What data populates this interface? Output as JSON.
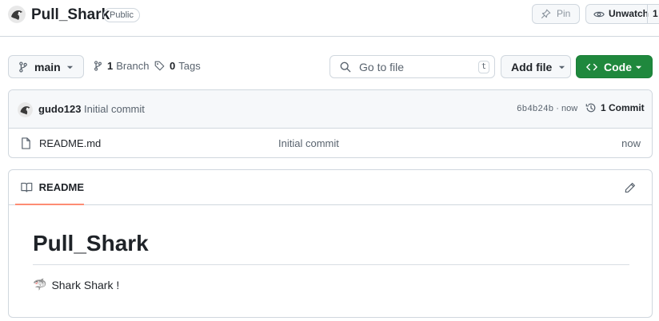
{
  "repo": {
    "name": "Pull_Shark",
    "visibility": "Public"
  },
  "actions": {
    "pin_label": "Pin",
    "watch_label": "Unwatch",
    "watch_count": "1"
  },
  "toolbar": {
    "branch_name": "main",
    "branches_count": "1",
    "branches_label": "Branch",
    "tags_count": "0",
    "tags_label": "Tags",
    "search_placeholder": "Go to file",
    "search_shortcut": "t",
    "add_file_label": "Add file",
    "code_label": "Code"
  },
  "commit": {
    "author": "gudo123",
    "message": "Initial commit",
    "sha": "6b4b24b",
    "time": "now",
    "count_label": "1 Commit"
  },
  "files": [
    {
      "name": "README.md",
      "message": "Initial commit",
      "time": "now"
    }
  ],
  "readme": {
    "tab_label": "README",
    "title": "Pull_Shark",
    "emoji": "🦈",
    "body": "Shark Shark !"
  },
  "colors": {
    "primary_green": "#1f883d",
    "tab_underline": "#fd8c73",
    "border": "#d0d7de"
  },
  "icons": [
    "avatar",
    "pin-icon",
    "eye-icon",
    "branch-icon",
    "tag-icon",
    "search-icon",
    "code-icon",
    "history-icon",
    "file-icon",
    "book-icon",
    "pencil-icon",
    "triangle-down-icon"
  ]
}
